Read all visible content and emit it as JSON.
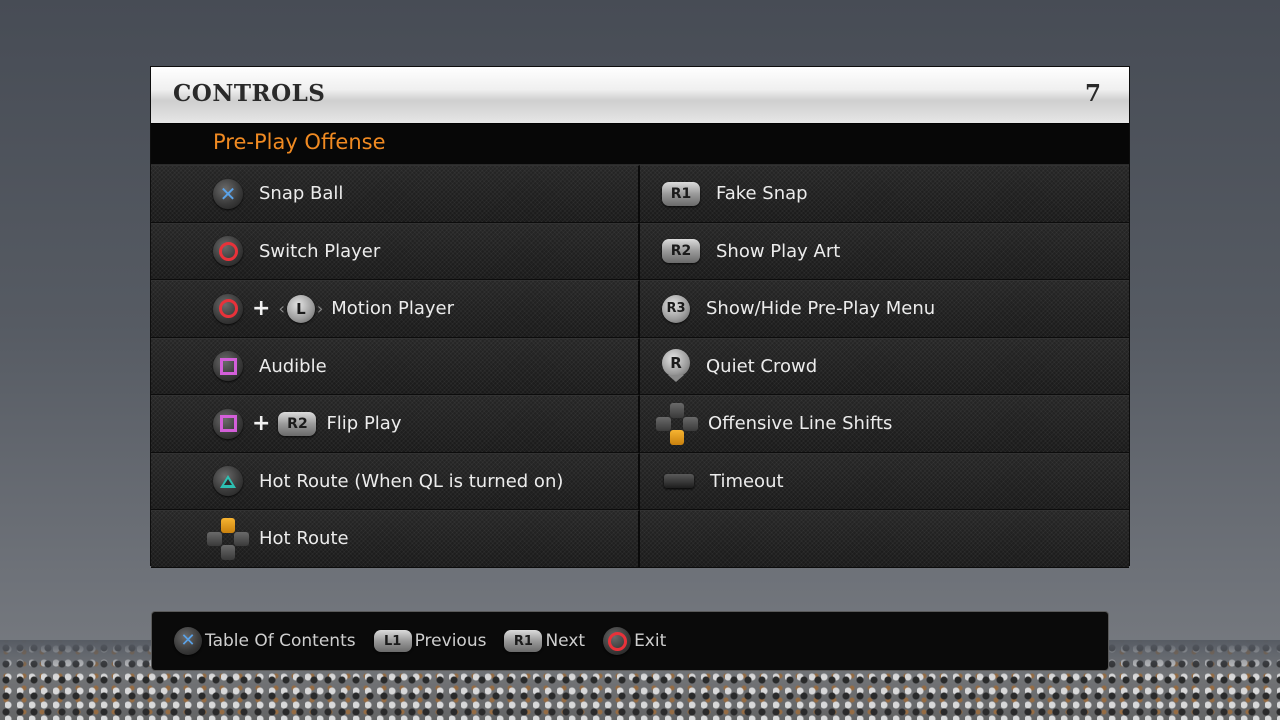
{
  "header": {
    "title": "CONTROLS",
    "page": "7"
  },
  "section": {
    "title": "Pre-Play Offense"
  },
  "left_controls": [
    {
      "label": "Snap Ball",
      "button": "cross-button"
    },
    {
      "label": "Switch Player",
      "button": "circle-button"
    },
    {
      "label": "Motion Player",
      "button": "circle-button",
      "plus": "+",
      "button2_text": "L"
    },
    {
      "label": "Audible",
      "button": "square-button"
    },
    {
      "label": "Flip Play",
      "button": "square-button",
      "plus": "+",
      "button2_text": "R2"
    },
    {
      "label": "Hot Route (When QL is turned on)",
      "button": "triangle-button"
    },
    {
      "label": "Hot Route",
      "button": "dpad-up"
    }
  ],
  "right_controls": [
    {
      "label": "Fake Snap",
      "button_text": "R1"
    },
    {
      "label": "Show Play Art",
      "button_text": "R2"
    },
    {
      "label": "Show/Hide Pre-Play Menu",
      "button_text": "R3"
    },
    {
      "label": "Quiet Crowd",
      "button_text": "R"
    },
    {
      "label": "Offensive Line Shifts",
      "button": "dpad-down"
    },
    {
      "label": "Timeout",
      "button": "select-button"
    }
  ],
  "nav": {
    "toc": {
      "label": "Table Of Contents"
    },
    "previous": {
      "label": "Previous",
      "button_text": "L1"
    },
    "next": {
      "label": "Next",
      "button_text": "R1"
    },
    "exit": {
      "label": "Exit"
    }
  },
  "colors": {
    "accent_orange": "#f08a22",
    "cross_blue": "#5aa2e8",
    "circle_red": "#e8323a",
    "square_pink": "#d35fd9",
    "triangle_teal": "#2dc0b2",
    "dpad_gold": "#f7b431"
  }
}
